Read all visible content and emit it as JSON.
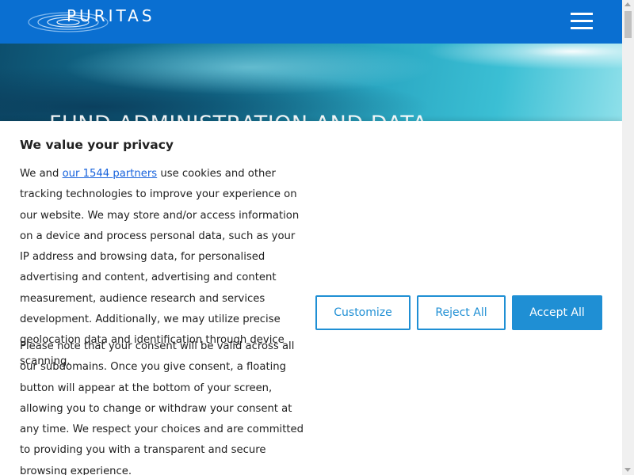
{
  "header": {
    "brand": "PURITAS",
    "menu_icon": "hamburger-menu-icon",
    "background_color": "#0a6fd1"
  },
  "hero": {
    "title": "FUND ADMINISTRATION AND DATA"
  },
  "consent": {
    "title": "We value your privacy",
    "p1_prefix": "We and ",
    "partners_link": "our 1544 partners",
    "p1_suffix": " use cookies and other tracking technologies to improve your experience on our website. We may store and/or access information on a device and process personal data, such as your IP address and browsing data, for personalised advertising and content, advertising and content measurement, audience research and services development. Additionally, we may utilize precise geolocation data and identification through device scanning.",
    "p2": "Please note that your consent will be valid across all our subdomains. Once you give consent, a floating button will appear at the bottom of your screen, allowing you to change or withdraw your consent at any time. We respect your choices and are committed to providing you with a transparent and secure browsing experience.",
    "buttons": {
      "customize": "Customize",
      "reject": "Reject All",
      "accept": "Accept All"
    },
    "accent_color": "#1f8fd4"
  }
}
